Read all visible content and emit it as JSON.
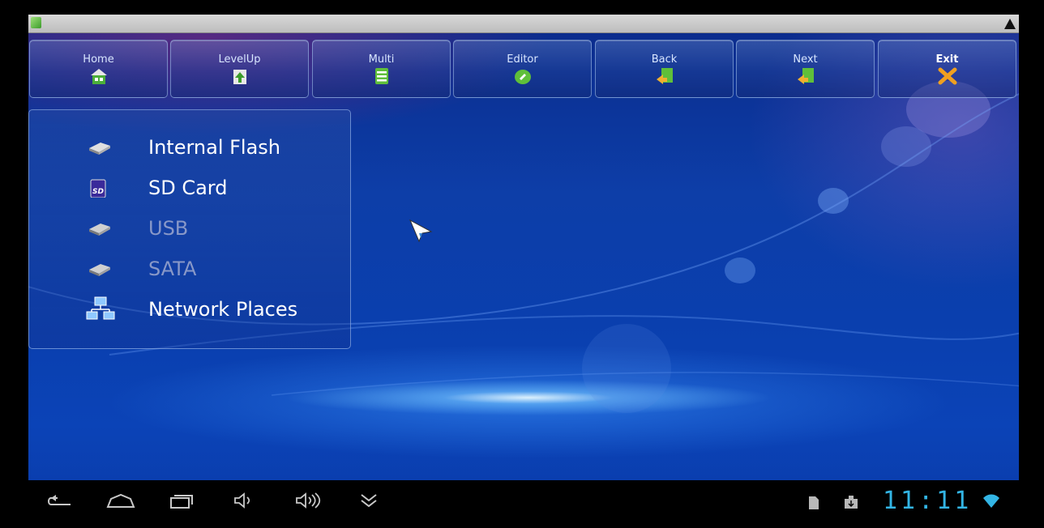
{
  "toolbar": {
    "buttons": [
      {
        "label": "Home",
        "icon": "home-icon"
      },
      {
        "label": "LevelUp",
        "icon": "level-up-icon"
      },
      {
        "label": "Multi",
        "icon": "multi-select-icon"
      },
      {
        "label": "Editor",
        "icon": "editor-icon"
      },
      {
        "label": "Back",
        "icon": "back-icon"
      },
      {
        "label": "Next",
        "icon": "next-icon"
      },
      {
        "label": "Exit",
        "icon": "exit-icon"
      }
    ]
  },
  "devices": [
    {
      "label": "Internal Flash",
      "icon": "drive-icon",
      "enabled": true
    },
    {
      "label": "SD Card",
      "icon": "sd-card-icon",
      "icon_text": "SD",
      "enabled": true
    },
    {
      "label": "USB",
      "icon": "drive-icon",
      "enabled": false
    },
    {
      "label": "SATA",
      "icon": "drive-icon",
      "enabled": false
    },
    {
      "label": "Network Places",
      "icon": "network-icon",
      "enabled": true
    }
  ],
  "navbar": {
    "icons": [
      "back-icon",
      "home-icon",
      "recent-apps-icon",
      "volume-down-icon",
      "volume-up-icon",
      "expand-icon"
    ],
    "status_icons": [
      "sd-card-icon",
      "download-icon",
      "wifi-icon"
    ],
    "clock": "11:11"
  },
  "colors": {
    "accent": "#33b5e5",
    "background": "#0d3ea8",
    "disabled_text": "#8898c8"
  }
}
